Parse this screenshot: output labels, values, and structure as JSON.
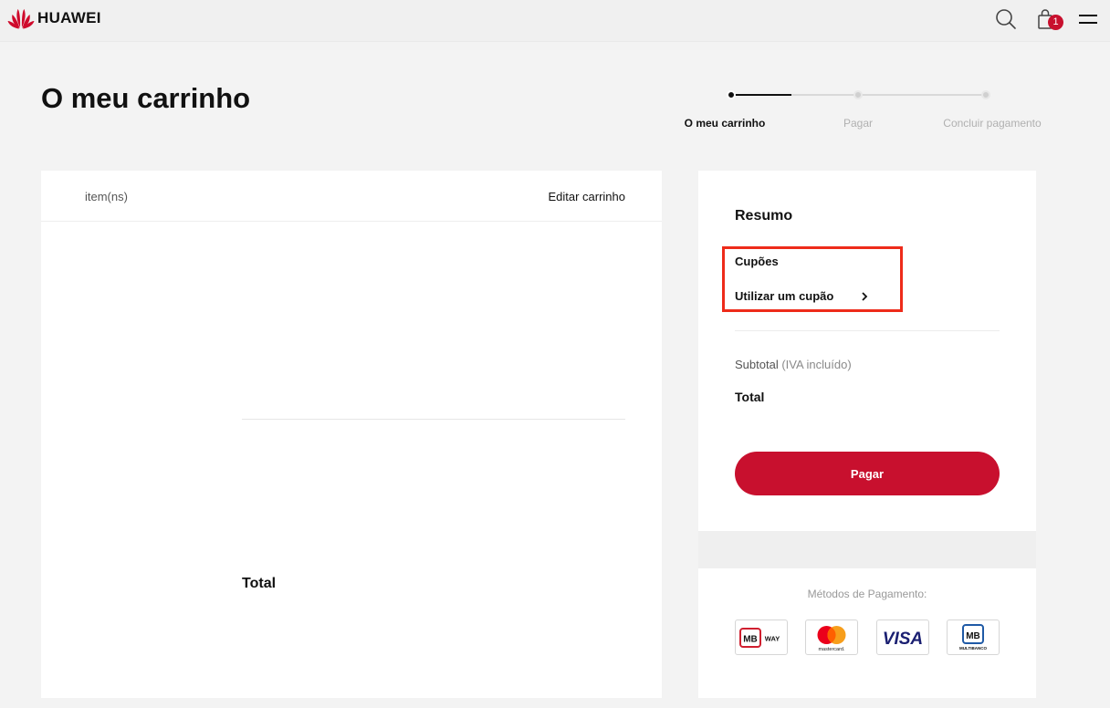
{
  "header": {
    "brand": "HUAWEI",
    "cart_count": "1",
    "icons": [
      "huawei-logo-icon",
      "search-icon",
      "shopping-bag-icon",
      "menu-icon"
    ]
  },
  "page": {
    "title": "O meu carrinho"
  },
  "stepper": {
    "steps": [
      {
        "label": "O meu carrinho",
        "active": true
      },
      {
        "label": "Pagar",
        "active": false
      },
      {
        "label": "Concluir pagamento",
        "active": false
      }
    ]
  },
  "cart": {
    "items_label": "item(ns)",
    "edit_label": "Editar carrinho",
    "total_label": "Total"
  },
  "summary": {
    "title": "Resumo",
    "coupons_title": "Cupões",
    "use_coupon_label": "Utilizar um cupão",
    "subtotal_label": "Subtotal",
    "vat_note": "(IVA incluído)",
    "total_label": "Total",
    "pay_button": "Pagar"
  },
  "payments": {
    "label": "Métodos de Pagamento:",
    "methods": [
      {
        "name": "MB WAY",
        "icon": "mbway-icon"
      },
      {
        "name": "mastercard",
        "icon": "mastercard-icon"
      },
      {
        "name": "VISA",
        "icon": "visa-icon"
      },
      {
        "name": "MULTIBANCO",
        "icon": "multibanco-icon"
      }
    ]
  },
  "colors": {
    "brand_red": "#c8102e",
    "highlight_red": "#ee2b1a",
    "background": "#f3f3f3"
  }
}
